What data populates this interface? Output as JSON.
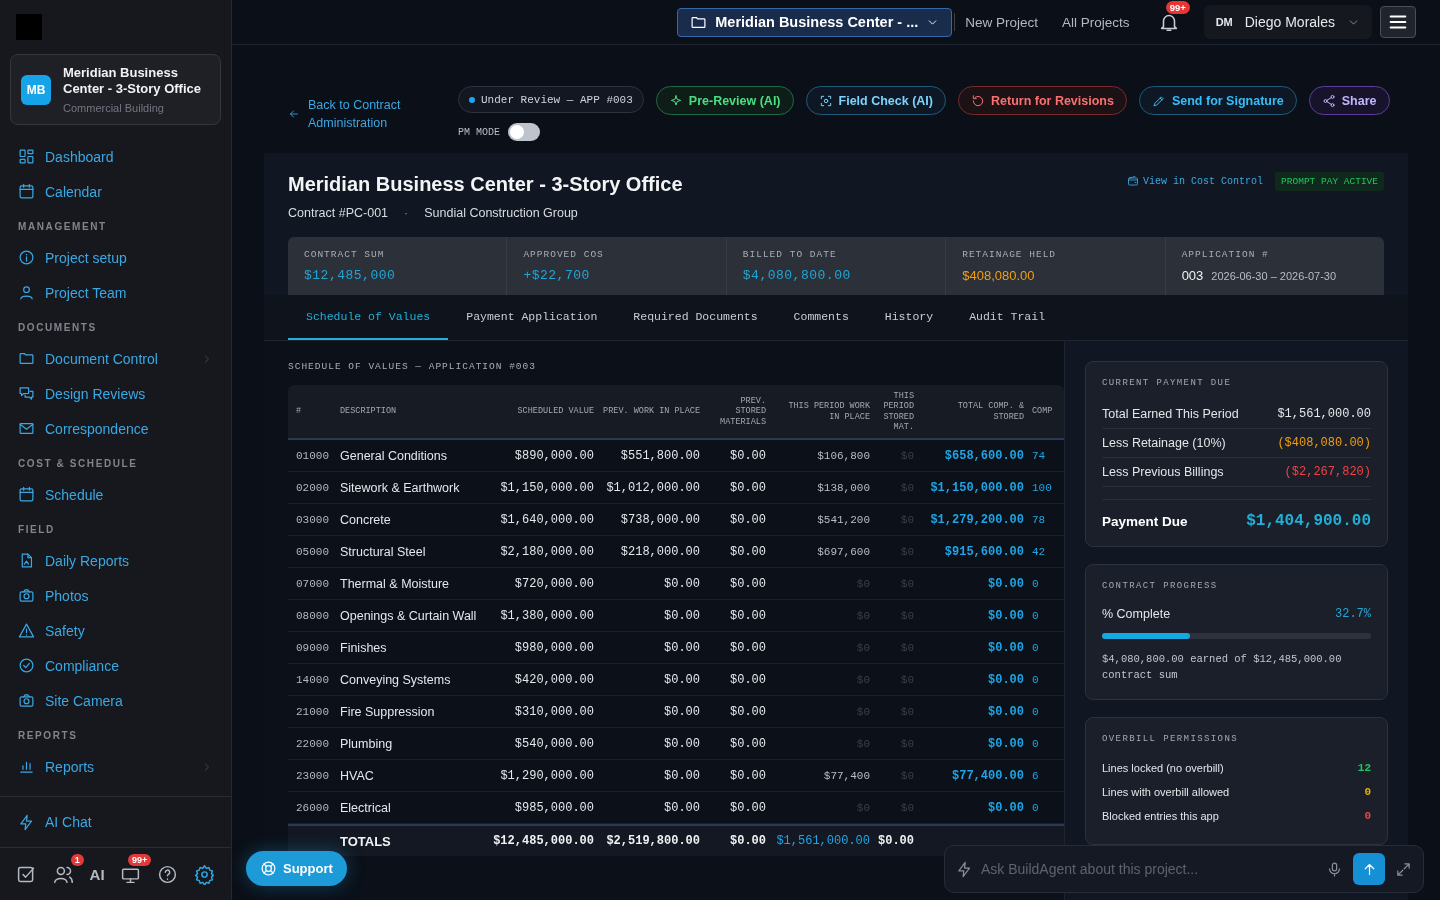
{
  "topbar": {
    "project_selector": "Meridian Business Center - ...",
    "links": [
      "New Project",
      "All Projects"
    ],
    "notifications": "99+",
    "user": {
      "initials": "DM",
      "name": "Diego Morales"
    }
  },
  "sidebar": {
    "project": {
      "initials": "MB",
      "name": "Meridian Business Center - 3-Story Office",
      "type": "Commercial Building"
    },
    "sections": [
      {
        "items": [
          {
            "label": "Dashboard",
            "submenu": false
          },
          {
            "label": "Calendar",
            "submenu": false
          }
        ]
      },
      {
        "heading": "MANAGEMENT",
        "items": [
          {
            "label": "Project setup",
            "submenu": false
          },
          {
            "label": "Project Team",
            "submenu": false
          }
        ]
      },
      {
        "heading": "DOCUMENTS",
        "items": [
          {
            "label": "Document Control",
            "submenu": true
          },
          {
            "label": "Design Reviews",
            "submenu": false
          },
          {
            "label": "Correspondence",
            "submenu": false
          }
        ]
      },
      {
        "heading": "COST & SCHEDULE",
        "items": [
          {
            "label": "Schedule",
            "submenu": false
          }
        ]
      },
      {
        "heading": "FIELD",
        "items": [
          {
            "label": "Daily Reports",
            "submenu": false
          },
          {
            "label": "Photos",
            "submenu": false
          },
          {
            "label": "Safety",
            "submenu": false
          },
          {
            "label": "Compliance",
            "submenu": false
          },
          {
            "label": "Site Camera",
            "submenu": false
          }
        ]
      },
      {
        "heading": "REPORTS",
        "items": [
          {
            "label": "Reports",
            "submenu": true
          }
        ]
      }
    ],
    "ai_chat": "AI Chat",
    "team_badge": "1",
    "ai_label": "AI",
    "alerts_badge": "99+"
  },
  "header": {
    "back_link": "Back to Contract Administration",
    "status": "Under Review — APP #003",
    "pm_mode": {
      "label": "PM MODE",
      "on": false
    },
    "actions": [
      {
        "label": "Pre-Review (AI)",
        "kind": "ai"
      },
      {
        "label": "Field Check (AI)",
        "kind": "scan"
      },
      {
        "label": "Return for Revisions",
        "kind": "revise"
      },
      {
        "label": "Send for Signature",
        "kind": "sign"
      },
      {
        "label": "Share",
        "kind": "share"
      }
    ]
  },
  "contract": {
    "title": "Meridian Business Center - 3-Story Office",
    "number": "Contract #PC-001",
    "separator": "·",
    "contractor": "Sundial Construction Group",
    "cost_link": "View in Cost Control",
    "badge": "PROMPT PAY ACTIVE",
    "stats": [
      {
        "label": "CONTRACT SUM",
        "value": "$12,485,000",
        "kind": "money"
      },
      {
        "label": "APPROVED COS",
        "value": "+$22,700",
        "kind": "money"
      },
      {
        "label": "BILLED TO DATE",
        "value": "$4,080,800.00",
        "kind": "money"
      },
      {
        "label": "RETAINAGE HELD",
        "value": "$408,080.00",
        "kind": "held"
      },
      {
        "label": "APPLICATION #",
        "value": "003",
        "period": "2026-06-30 – 2026-07-30",
        "kind": "app"
      }
    ]
  },
  "tabs": [
    {
      "label": "Schedule of Values",
      "selected": true
    },
    {
      "label": "Payment Application",
      "selected": false
    },
    {
      "label": "Required Documents",
      "selected": false
    },
    {
      "label": "Comments",
      "selected": false
    },
    {
      "label": "History",
      "selected": false
    },
    {
      "label": "Audit Trail",
      "selected": false
    }
  ],
  "sov": {
    "title": "SCHEDULE OF VALUES — APPLICATION #003",
    "columns": [
      "#",
      "DESCRIPTION",
      "SCHEDULED VALUE",
      "PREV. WORK IN PLACE",
      "PREV. STORED MATERIALS",
      "THIS PERIOD WORK IN PLACE",
      "THIS PERIOD STORED MAT.",
      "TOTAL COMP. & STORED",
      "COMP"
    ],
    "rows": [
      {
        "cells": [
          "01000",
          "General Conditions",
          "$890,000.00",
          "$551,800.00",
          "$0.00",
          "$106,800",
          "$0",
          "$658,600.00",
          "74"
        ],
        "billed": true
      },
      {
        "cells": [
          "02000",
          "Sitework & Earthwork",
          "$1,150,000.00",
          "$1,012,000.00",
          "$0.00",
          "$138,000",
          "$0",
          "$1,150,000.00",
          "100"
        ],
        "billed": true
      },
      {
        "cells": [
          "03000",
          "Concrete",
          "$1,640,000.00",
          "$738,000.00",
          "$0.00",
          "$541,200",
          "$0",
          "$1,279,200.00",
          "78"
        ],
        "billed": true
      },
      {
        "cells": [
          "05000",
          "Structural Steel",
          "$2,180,000.00",
          "$218,000.00",
          "$0.00",
          "$697,600",
          "$0",
          "$915,600.00",
          "42"
        ],
        "billed": true
      },
      {
        "cells": [
          "07000",
          "Thermal & Moisture",
          "$720,000.00",
          "$0.00",
          "$0.00",
          "$0",
          "$0",
          "$0.00",
          "0"
        ],
        "billed": false
      },
      {
        "cells": [
          "08000",
          "Openings & Curtain Wall",
          "$1,380,000.00",
          "$0.00",
          "$0.00",
          "$0",
          "$0",
          "$0.00",
          "0"
        ],
        "billed": false
      },
      {
        "cells": [
          "09000",
          "Finishes",
          "$980,000.00",
          "$0.00",
          "$0.00",
          "$0",
          "$0",
          "$0.00",
          "0"
        ],
        "billed": false
      },
      {
        "cells": [
          "14000",
          "Conveying Systems",
          "$420,000.00",
          "$0.00",
          "$0.00",
          "$0",
          "$0",
          "$0.00",
          "0"
        ],
        "billed": false
      },
      {
        "cells": [
          "21000",
          "Fire Suppression",
          "$310,000.00",
          "$0.00",
          "$0.00",
          "$0",
          "$0",
          "$0.00",
          "0"
        ],
        "billed": false
      },
      {
        "cells": [
          "22000",
          "Plumbing",
          "$540,000.00",
          "$0.00",
          "$0.00",
          "$0",
          "$0",
          "$0.00",
          "0"
        ],
        "billed": false
      },
      {
        "cells": [
          "23000",
          "HVAC",
          "$1,290,000.00",
          "$0.00",
          "$0.00",
          "$77,400",
          "$0",
          "$77,400.00",
          "6"
        ],
        "billed": true
      },
      {
        "cells": [
          "26000",
          "Electrical",
          "$985,000.00",
          "$0.00",
          "$0.00",
          "$0",
          "$0",
          "$0.00",
          "0"
        ],
        "billed": false
      }
    ],
    "totals": [
      "TOTALS",
      "$12,485,000.00",
      "$2,519,800.00",
      "$0.00",
      "$1,561,000.00",
      "$0.00"
    ]
  },
  "payment": {
    "title": "CURRENT PAYMENT DUE",
    "rows": [
      {
        "label": "Total Earned This Period",
        "value": "$1,561,000.00",
        "kind": "plain"
      },
      {
        "label": "Less Retainage (10%)",
        "value": "($408,080.00)",
        "kind": "retainage"
      },
      {
        "label": "Less Previous Billings",
        "value": "($2,267,820)",
        "kind": "deduction"
      }
    ],
    "due_label": "Payment Due",
    "due_value": "$1,404,900.00"
  },
  "progress": {
    "title": "CONTRACT PROGRESS",
    "label": "% Complete",
    "value": "32.7%",
    "level": 0.327,
    "note": "$4,080,800.00 earned of $12,485,000.00 contract sum"
  },
  "overbill": {
    "title": "OVERBILL PERMISSIONS",
    "rows": [
      {
        "label": "Lines locked (no overbill)",
        "value": "12",
        "color": "#22c55e"
      },
      {
        "label": "Lines with overbill allowed",
        "value": "0",
        "color": "#eab308"
      },
      {
        "label": "Blocked entries this app",
        "value": "0",
        "color": "#ef4444"
      }
    ]
  },
  "support": "Support",
  "chat": {
    "placeholder": "Ask BuildAgent about this project..."
  }
}
